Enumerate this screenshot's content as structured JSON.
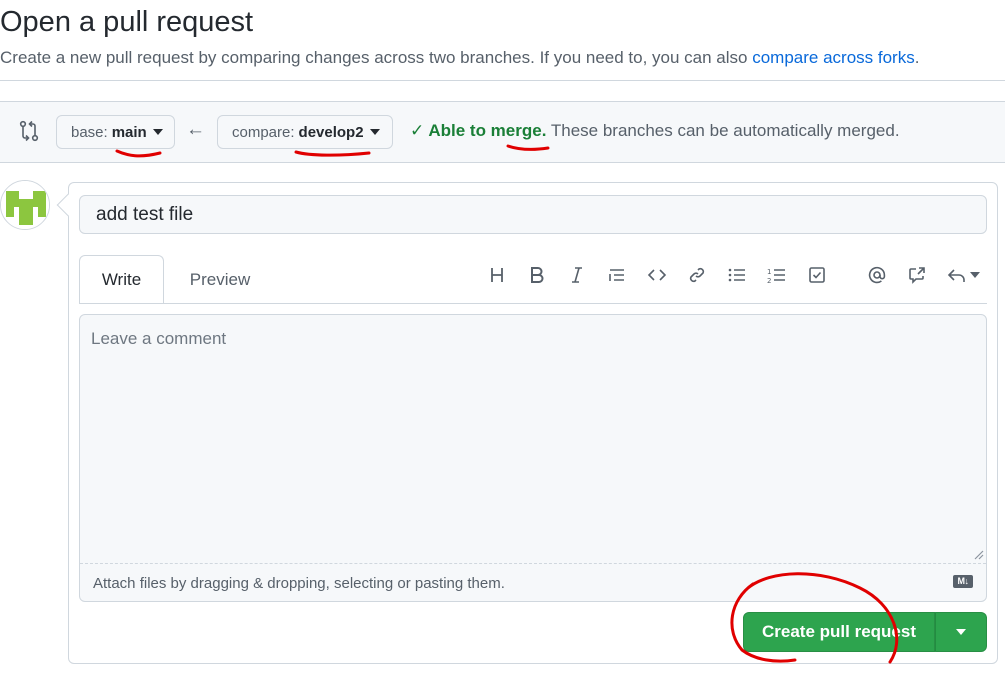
{
  "header": {
    "title": "Open a pull request",
    "subtitle_text": "Create a new pull request by comparing changes across two branches. If you need to, you can also ",
    "subtitle_link": "compare across forks",
    "subtitle_end": "."
  },
  "compare_bar": {
    "base_label": "base:",
    "base_branch": "main",
    "compare_label": "compare:",
    "compare_branch": "develop2",
    "status_ok": "Able to merge.",
    "status_text": " These branches can be automatically merged."
  },
  "form": {
    "title_value": "add test file",
    "tabs": [
      "Write",
      "Preview"
    ],
    "comment_placeholder": "Leave a comment",
    "attach_text": "Attach files by dragging & dropping, selecting or pasting them.",
    "markdown_badge": "M↓",
    "submit_label": "Create pull request"
  },
  "toolbar_icons": [
    "heading-icon",
    "bold-icon",
    "italic-icon",
    "quote-icon",
    "code-icon",
    "link-icon",
    "bulleted-list-icon",
    "numbered-list-icon",
    "task-list-icon",
    "mention-icon",
    "cross-reference-icon",
    "reply-icon"
  ],
  "colors": {
    "accent_green": "#2da44e",
    "link_blue": "#0969da",
    "success_text": "#1a7f37",
    "annotation_red": "#e00000"
  }
}
